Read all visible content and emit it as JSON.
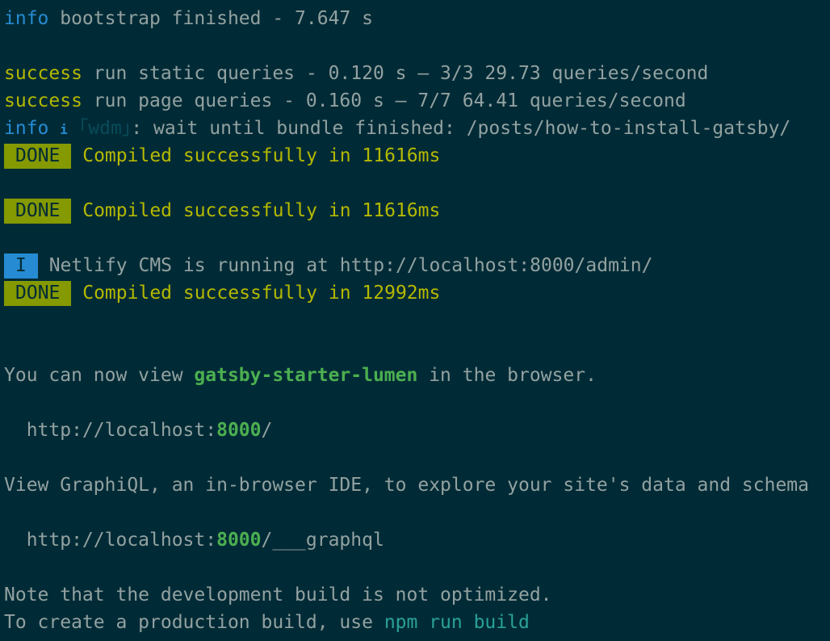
{
  "lines": {
    "bootstrap": {
      "level": "info",
      "text": " bootstrap finished - 7.647 s"
    },
    "static_queries": {
      "level": "success",
      "text": " run static queries - 0.120 s — 3/3 29.73 queries/second"
    },
    "page_queries": {
      "level": "success",
      "text": " run page queries - 0.160 s — 7/7 64.41 queries/second"
    },
    "wdm": {
      "level": "info",
      "icon": "i",
      "module": "｢wdm｣",
      "text": ": wait until bundle finished: /posts/how-to-install-gatsby/"
    },
    "done1": {
      "badge": "DONE",
      "text": " Compiled successfully in 11616ms"
    },
    "done2": {
      "badge": "DONE",
      "text": " Compiled successfully in 11616ms"
    },
    "netlify": {
      "badge": "I",
      "text": " Netlify CMS is running at http://localhost:8000/admin/"
    },
    "done3": {
      "badge": "DONE",
      "text": " Compiled successfully in 12992ms"
    },
    "view_prefix": "You can now view ",
    "view_site": "gatsby-starter-lumen",
    "view_suffix": " in the browser.",
    "url1_prefix": "  http://localhost:",
    "url1_port": "8000",
    "url1_suffix": "/",
    "graphiql": "View GraphiQL, an in-browser IDE, to explore your site's data and schema",
    "url2_prefix": "  http://localhost:",
    "url2_port": "8000",
    "url2_suffix": "/___graphql",
    "note": "Note that the development build is not optimized.",
    "prod_prefix": "To create a production build, use ",
    "prod_cmd": "npm run build"
  },
  "colors": {
    "background": "#002b36",
    "text": "#93a1a1",
    "info": "#268bd2",
    "success": "#b5b800",
    "done_badge": "#859900",
    "highlight_green": "#4caf50",
    "command": "#2aa198"
  }
}
